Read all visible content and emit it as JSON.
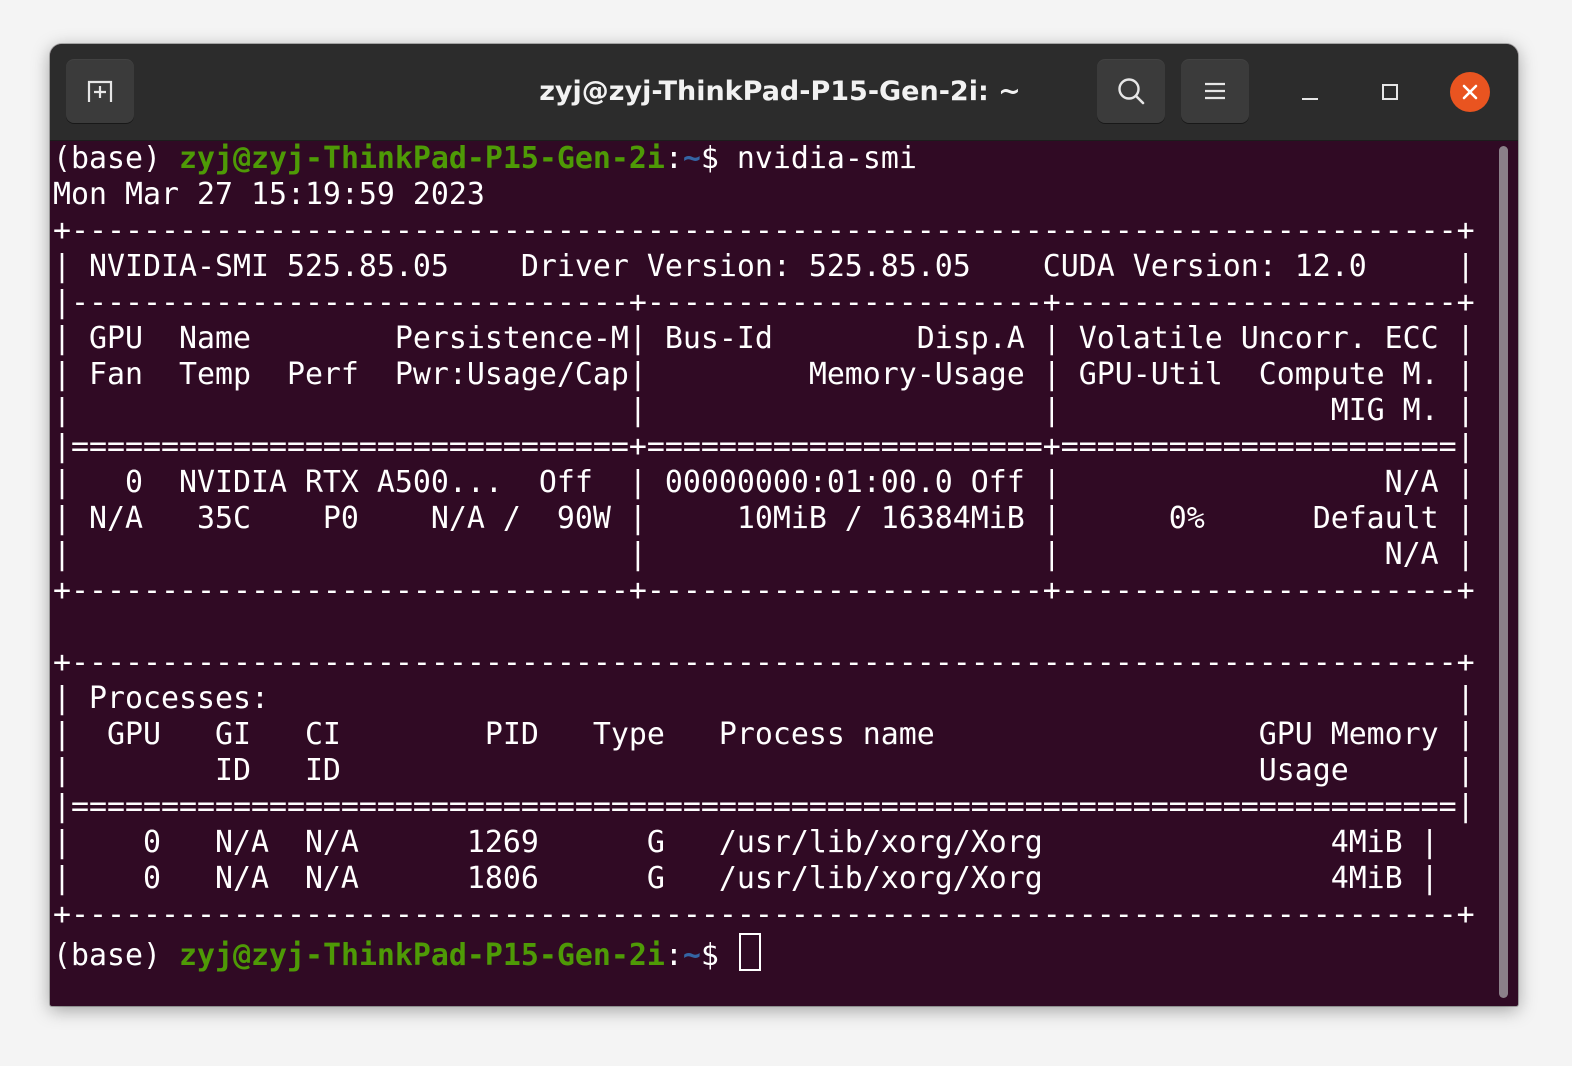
{
  "window": {
    "title": "zyj@zyj-ThinkPad-P15-Gen-2i: ~"
  },
  "colors": {
    "terminal_bg": "#300a24",
    "prompt_user": "#4e9a06",
    "prompt_path": "#3465a4",
    "close_button": "#e95420"
  },
  "icons": {
    "new_tab": "new-tab-icon",
    "search": "search-icon",
    "menu": "hamburger-menu-icon",
    "minimize": "minimize-icon",
    "maximize": "maximize-icon",
    "close": "close-icon"
  },
  "prompt": {
    "env": "(base) ",
    "user_host": "zyj@zyj-ThinkPad-P15-Gen-2i",
    "separator": ":",
    "path": "~",
    "symbol": "$ ",
    "command": "nvidia-smi"
  },
  "output": [
    "Mon Mar 27 15:19:59 2023",
    "+-----------------------------------------------------------------------------+",
    "| NVIDIA-SMI 525.85.05    Driver Version: 525.85.05    CUDA Version: 12.0     |",
    "|-------------------------------+----------------------+----------------------+",
    "| GPU  Name        Persistence-M| Bus-Id        Disp.A | Volatile Uncorr. ECC |",
    "| Fan  Temp  Perf  Pwr:Usage/Cap|         Memory-Usage | GPU-Util  Compute M. |",
    "|                               |                      |               MIG M. |",
    "|===============================+======================+======================|",
    "|   0  NVIDIA RTX A500...  Off  | 00000000:01:00.0 Off |                  N/A |",
    "| N/A   35C    P0    N/A /  90W |     10MiB / 16384MiB |      0%      Default |",
    "|                               |                      |                  N/A |",
    "+-------------------------------+----------------------+----------------------+",
    "",
    "+-----------------------------------------------------------------------------+",
    "| Processes:                                                                  |",
    "|  GPU   GI   CI        PID   Type   Process name                  GPU Memory |",
    "|        ID   ID                                                   Usage      |",
    "|=============================================================================|",
    "|    0   N/A  N/A      1269      G   /usr/lib/xorg/Xorg                4MiB |",
    "|    0   N/A  N/A      1806      G   /usr/lib/xorg/Xorg                4MiB |",
    "+-----------------------------------------------------------------------------+"
  ]
}
